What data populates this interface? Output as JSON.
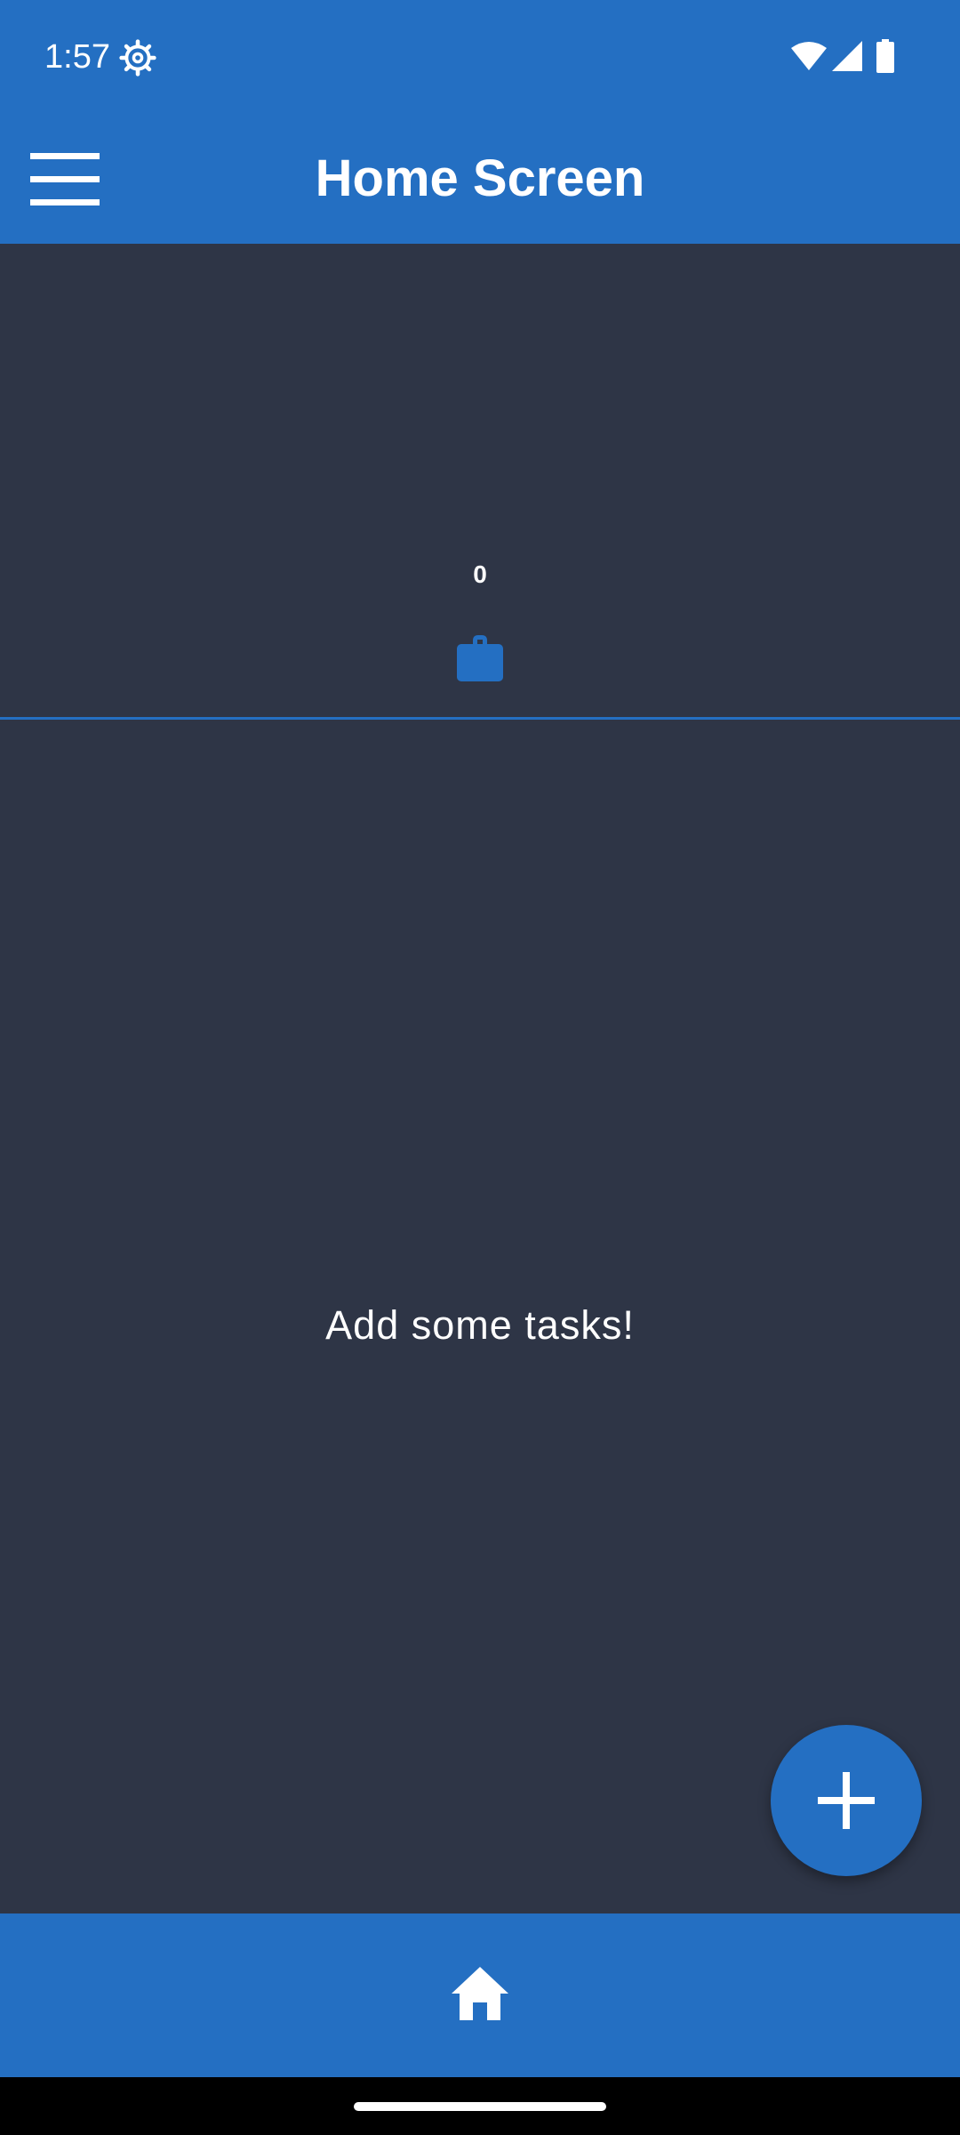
{
  "status_bar": {
    "time": "1:57",
    "icons": [
      "gear-icon",
      "wifi-icon",
      "signal-icon",
      "battery-icon"
    ]
  },
  "app_bar": {
    "title": "Home Screen",
    "menu_icon": "hamburger-menu-icon"
  },
  "summary": {
    "task_count": "0",
    "icon": "briefcase-icon"
  },
  "main": {
    "empty_message": "Add some tasks!"
  },
  "fab": {
    "icon": "plus-icon"
  },
  "bottom_nav": {
    "items": [
      {
        "icon": "home-icon"
      }
    ]
  },
  "colors": {
    "primary": "#246fc2",
    "background": "#2e3546",
    "text": "#ffffff"
  }
}
